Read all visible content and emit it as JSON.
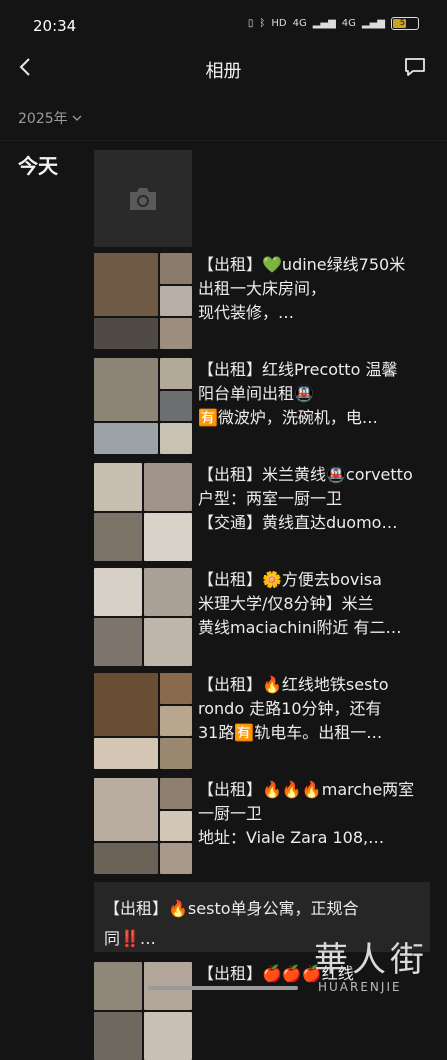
{
  "status": {
    "time": "20:34",
    "signal1": "4G",
    "signal2": "4G",
    "battery": "57",
    "battery_level": 0.57,
    "hd_label": "HD"
  },
  "nav": {
    "title": "相册"
  },
  "filter": {
    "year": "2025年"
  },
  "section": {
    "date": "今天"
  },
  "posts": [
    {
      "text": "【出租】💚udine绿线750米\n出租一大床房间，\n现代装修，…",
      "colors": [
        "#6e5a45",
        "#8b7b6a",
        "#b7aea5",
        "#4f4a44",
        "#9d8f80",
        "#c7c0b7"
      ]
    },
    {
      "text": "【出租】红线Precotto 温馨\n阳台单间出租🚇\n🈶微波炉，洗碗机，电…",
      "colors": [
        "#8d8478",
        "#b3a999",
        "#6c6e6f",
        "#9ba3a8",
        "#c9c1b4",
        "#7f7464"
      ]
    },
    {
      "text": "【出租】米兰黄线🚇corvetto\n户型：两室一厨一卫\n【交通】黄线直达duomo…",
      "colors": [
        "#c7bfb2",
        "#a0948a",
        "#7c7469",
        "#d8d2c8"
      ]
    },
    {
      "text": " 【出租】🌼方便去bovisa\n米理大学/仅8分钟】米兰\n黄线maciachini附近 有二…",
      "colors": [
        "#d6d0c6",
        "#a9a196",
        "#7d756b",
        "#bfb7ab"
      ]
    },
    {
      "text": " 【出租】🔥红线地铁sesto\nrondo 走路10分钟，还有\n31路🈶轨电车。出租一…",
      "colors": [
        "#6a4e33",
        "#8a6a4c",
        "#b9a68e",
        "#d3c6b5",
        "#9a8770",
        "#4b3f33"
      ]
    },
    {
      "text": "【出租】🔥🔥🔥marche两室\n一厨一卫\n地址：Viale Zara 108,…",
      "colors": [
        "#b8ada0",
        "#8e8070",
        "#d2c6b6",
        "#6b6258",
        "#a79a8a",
        "#c3b9ab"
      ]
    }
  ],
  "text_post": {
    "text": "【出租】🔥sesto单身公寓，正规合\n同‼️…"
  },
  "last_post": {
    "text": "【出租】🍎🍎🍎红线",
    "colors": [
      "#8f8779",
      "#b1a699",
      "#6f685f",
      "#c8c0b4"
    ]
  },
  "watermark": {
    "big": "華人街",
    "small": "HUARENJIE"
  }
}
